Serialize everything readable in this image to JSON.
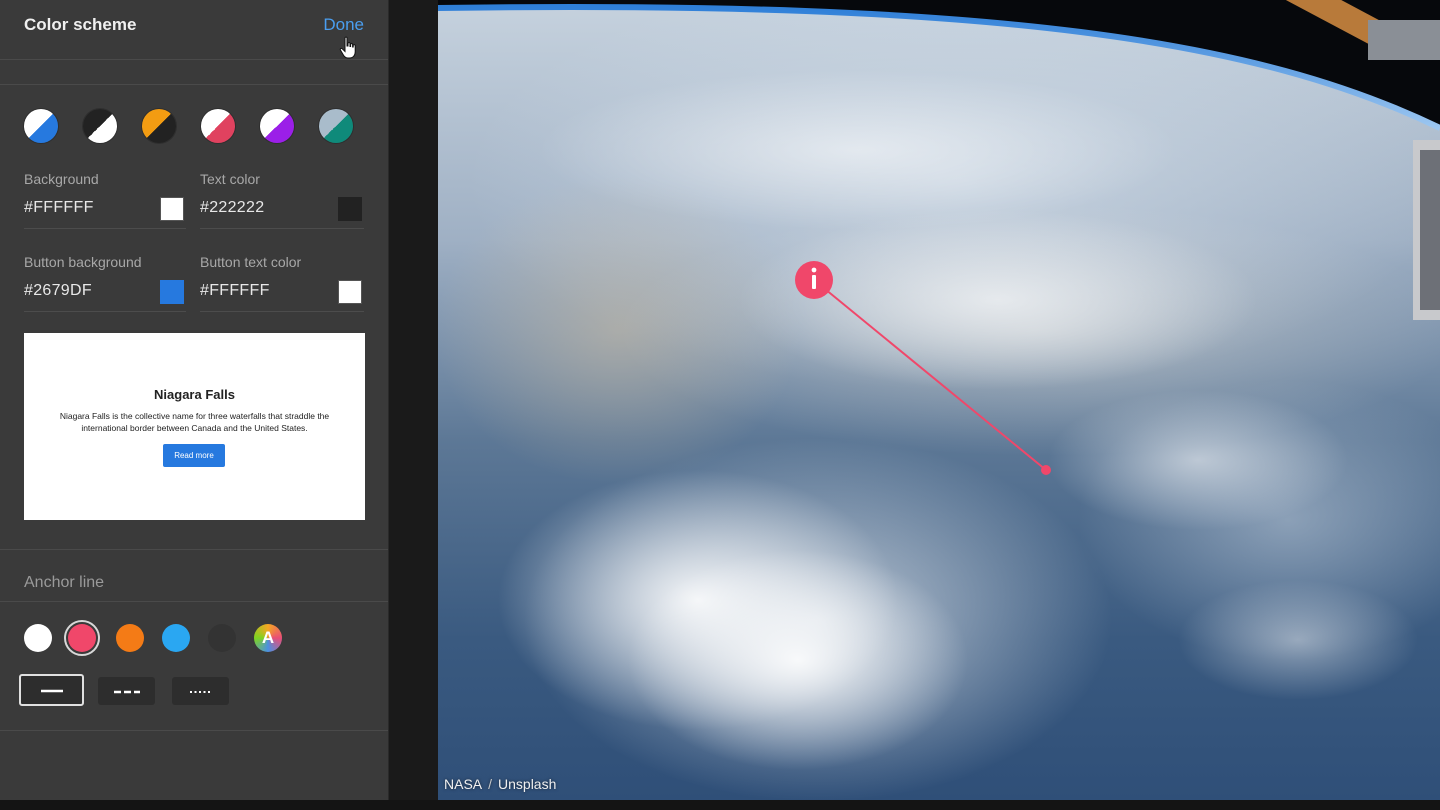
{
  "panel": {
    "title": "Color scheme",
    "done_label": "Done",
    "presets": [
      {
        "name": "blue-white",
        "a": "#ffffff",
        "b": "#2679DF"
      },
      {
        "name": "black-white",
        "a": "#222222",
        "b": "#ffffff"
      },
      {
        "name": "orange-black",
        "a": "#f39c12",
        "b": "#222222"
      },
      {
        "name": "white-crimson",
        "a": "#ffffff",
        "b": "#e0425f"
      },
      {
        "name": "white-purple",
        "a": "#ffffff",
        "b": "#9b1fe8"
      },
      {
        "name": "grey-teal",
        "a": "#a9bccb",
        "b": "#0f8a7a"
      }
    ],
    "fields": {
      "background": {
        "label": "Background",
        "value": "#FFFFFF",
        "color": "#FFFFFF"
      },
      "text_color": {
        "label": "Text color",
        "value": "#222222",
        "color": "#222222"
      },
      "button_background": {
        "label": "Button background",
        "value": "#2679DF",
        "color": "#2679DF"
      },
      "button_text_color": {
        "label": "Button text color",
        "value": "#FFFFFF",
        "color": "#FFFFFF"
      }
    },
    "preview": {
      "title": "Niagara Falls",
      "body": "Niagara Falls is the collective name for three waterfalls that straddle the international border between Canada and the United States.",
      "button_label": "Read more"
    },
    "anchor_line": {
      "title": "Anchor line",
      "colors": [
        {
          "name": "white",
          "color": "#ffffff"
        },
        {
          "name": "pink",
          "color": "#f0476a"
        },
        {
          "name": "orange",
          "color": "#f47b16"
        },
        {
          "name": "sky-blue",
          "color": "#2aa7f2"
        },
        {
          "name": "charcoal",
          "color": "#333333"
        }
      ],
      "selected_color": "pink",
      "auto_label": "A",
      "styles": [
        "solid",
        "dashed",
        "dotted"
      ],
      "selected_style": "solid"
    }
  },
  "photo": {
    "hotspot_icon": "info-icon",
    "hotspot_color": "#f0476a",
    "credit_author": "NASA",
    "credit_separator": "/",
    "credit_source": "Unsplash"
  }
}
